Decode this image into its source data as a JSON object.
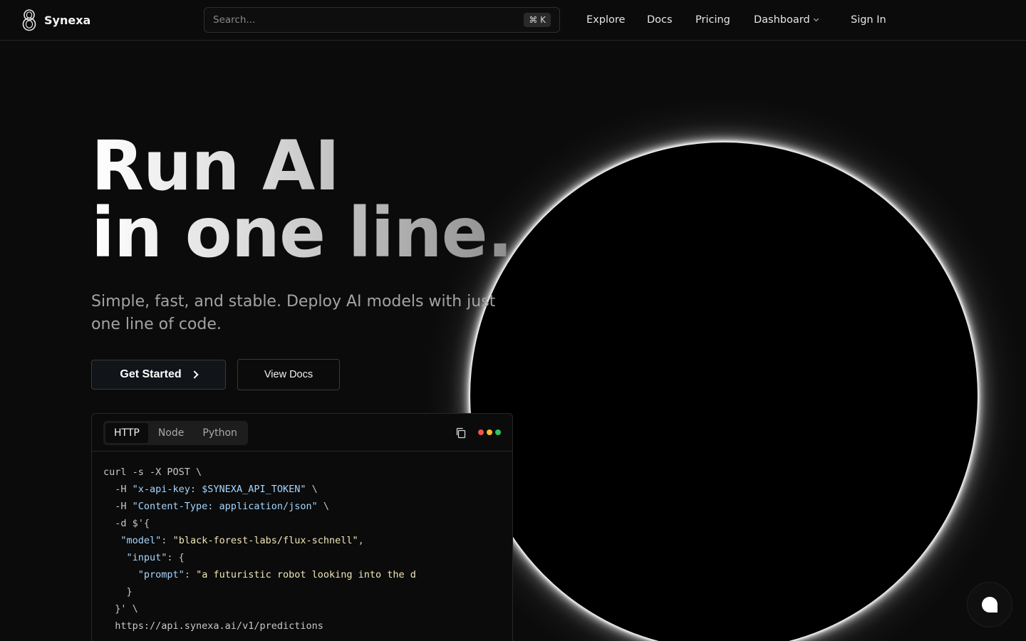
{
  "brand": {
    "name": "Synexa"
  },
  "search": {
    "placeholder": "Search...",
    "shortcut": "⌘ K"
  },
  "nav": {
    "explore": "Explore",
    "docs": "Docs",
    "pricing": "Pricing",
    "dashboard": "Dashboard",
    "sign_in": "Sign In"
  },
  "hero": {
    "title_line1": "Run AI",
    "title_line2": "in one line.",
    "subtitle": "Simple, fast, and stable. Deploy AI models with just one line of code.",
    "primary_cta": "Get Started",
    "secondary_cta": "View Docs"
  },
  "code_card": {
    "tabs": [
      "HTTP",
      "Node",
      "Python"
    ],
    "active_tab": "HTTP",
    "window_dot_colors": [
      "#ef5350",
      "#f5b82e",
      "#2ec55e"
    ],
    "lines": [
      {
        "p": "curl -s -X POST \\"
      },
      {
        "p": "  -H ",
        "s": "\"x-api-key: $SYNEXA_API_TOKEN\"",
        "t": " \\"
      },
      {
        "p": "  -H ",
        "s": "\"Content-Type: application/json\"",
        "t": " \\"
      },
      {
        "p": "  -d $'{"
      },
      {
        "p": "   ",
        "s": "\"model\"",
        "m": ": ",
        "y": "\"black-forest-labs/flux-schnell\"",
        "t": ","
      },
      {
        "p": "    ",
        "s": "\"input\"",
        "t": ": {"
      },
      {
        "p": "      ",
        "s": "\"prompt\"",
        "m": ": ",
        "y": "\"a futuristic robot looking into the d"
      },
      {
        "p": "    }"
      },
      {
        "p": "  }' \\"
      },
      {
        "p": "  https://api.synexa.ai/v1/predictions"
      }
    ]
  },
  "icons": {
    "logo": "synexa-logo-icon",
    "copy": "copy-icon",
    "chat": "chat-bubble-icon",
    "arrow": "chevron-right-icon",
    "dropdown": "chevron-down-icon"
  }
}
